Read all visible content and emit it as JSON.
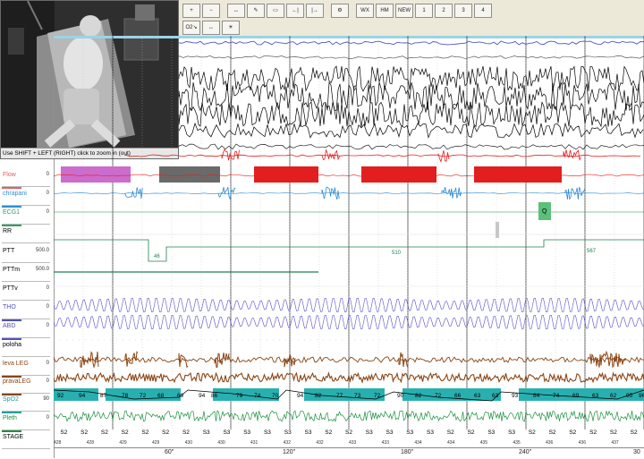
{
  "camera": {
    "hint": "Use SHIFT + LEFT (RIGHT) click to zoom in (out)"
  },
  "toolbar": {
    "row1": [
      "+",
      "−",
      "↔",
      "✎",
      "▭",
      "←|",
      "|→",
      "⚙",
      "WX",
      "HM",
      "NEW",
      "1",
      "2",
      "3",
      "4"
    ],
    "row2": [
      "O2↘",
      "↔",
      "☀"
    ]
  },
  "channels": [
    {
      "name": "Flow",
      "scale": "0",
      "color": "#e06060"
    },
    {
      "name": "chrapani",
      "scale": "0",
      "color": "#3090d0"
    },
    {
      "name": "ECG1",
      "scale": "0",
      "color": "#30a060"
    },
    {
      "name": "RR",
      "scale": "",
      "color": "#000000"
    },
    {
      "name": "PTT",
      "scale": "500.0",
      "color": "#000000"
    },
    {
      "name": "PTTm",
      "scale": "500.0",
      "color": "#000000"
    },
    {
      "name": "PTTv",
      "scale": "0",
      "color": "#000000"
    },
    {
      "name": "THO",
      "scale": "0",
      "color": "#5050c0"
    },
    {
      "name": "ABD",
      "scale": "0",
      "color": "#5050c0"
    },
    {
      "name": "poloha",
      "scale": "",
      "color": "#000000"
    },
    {
      "name": "leva LEG",
      "scale": "0",
      "color": "#8b4513"
    },
    {
      "name": "pravaLEG",
      "scale": "0",
      "color": "#8b4513"
    },
    {
      "name": "SpO2",
      "scale": "90",
      "color": "#20a0a0"
    },
    {
      "name": "Pleth",
      "scale": "0",
      "color": "#209040"
    },
    {
      "name": "STAGE",
      "scale": "",
      "color": "#000000"
    }
  ],
  "ptt_values": [
    "46",
    "510",
    "567"
  ],
  "ecg_marker": "Q",
  "spo2_values": [
    "92",
    "94",
    "87",
    "78",
    "72",
    "68",
    "69",
    "94",
    "86",
    "79",
    "74",
    "70",
    "94",
    "82",
    "77",
    "73",
    "72",
    "90",
    "82",
    "72",
    "66",
    "63",
    "63",
    "93",
    "84",
    "74",
    "69",
    "63",
    "62",
    "95",
    "96"
  ],
  "stages": [
    "S2",
    "S2",
    "S2",
    "S2",
    "S2",
    "S2",
    "S2",
    "S3",
    "S3",
    "S3",
    "S3",
    "S3",
    "S3",
    "S2",
    "S2",
    "S3",
    "S3",
    "S3",
    "S3",
    "S2",
    "S2",
    "S3",
    "S3",
    "S2",
    "S2",
    "S2",
    "S2",
    "S2",
    "S2"
  ],
  "epoch_numbers": [
    "428",
    "428",
    "429",
    "429",
    "430",
    "430",
    "431",
    "432",
    "432",
    "433",
    "433",
    "434",
    "434",
    "435",
    "435",
    "436",
    "436",
    "437"
  ],
  "time_ticks": [
    "60\"",
    "120\"",
    "180\"",
    "240\"",
    "30"
  ],
  "colors": {
    "flow_red": "#e31e1e",
    "flow_magenta": "#cc6ccc",
    "flow_gray": "#6a6a6a",
    "snore_blue": "#2a8ad4",
    "spo2_teal": "#28b0b0",
    "pleth_green": "#1a9040",
    "leg_brown": "#8b4513",
    "resp_purple": "#5a4fc8"
  }
}
